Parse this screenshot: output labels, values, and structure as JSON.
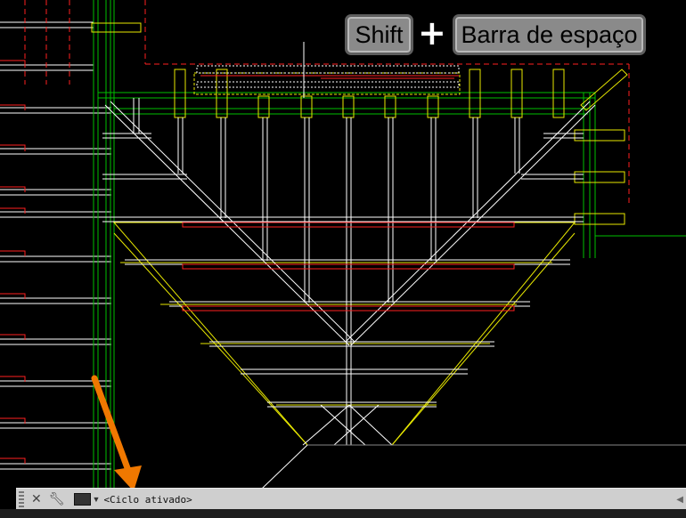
{
  "overlay": {
    "key1": "Shift",
    "plus": "+",
    "key2": "Barra de espaço"
  },
  "command_line": {
    "close_icon": "close-icon",
    "settings_icon": "wrench-icon",
    "prompt_icon": "terminal-icon",
    "text": "<Ciclo ativado>",
    "scroll_icon": "chevron-right-icon"
  },
  "colors": {
    "background": "#000000",
    "white_lines": "#ffffff",
    "red_lines": "#ff0000",
    "yellow_lines": "#ffff00",
    "green_lines": "#00c000",
    "arrow": "#f07800"
  }
}
